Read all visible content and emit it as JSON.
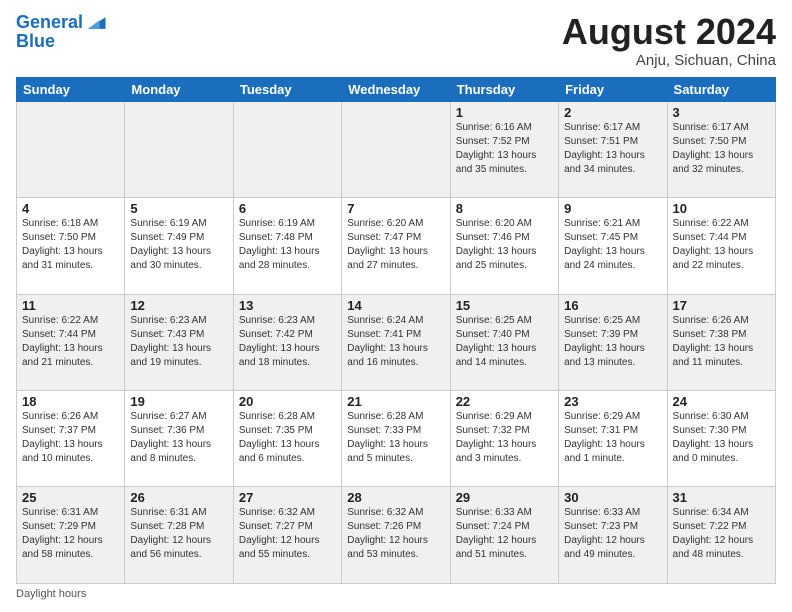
{
  "header": {
    "logo_line1": "General",
    "logo_line2": "Blue",
    "month_year": "August 2024",
    "location": "Anju, Sichuan, China"
  },
  "days_of_week": [
    "Sunday",
    "Monday",
    "Tuesday",
    "Wednesday",
    "Thursday",
    "Friday",
    "Saturday"
  ],
  "weeks": [
    [
      {
        "day": "",
        "info": ""
      },
      {
        "day": "",
        "info": ""
      },
      {
        "day": "",
        "info": ""
      },
      {
        "day": "",
        "info": ""
      },
      {
        "day": "1",
        "info": "Sunrise: 6:16 AM\nSunset: 7:52 PM\nDaylight: 13 hours and 35 minutes."
      },
      {
        "day": "2",
        "info": "Sunrise: 6:17 AM\nSunset: 7:51 PM\nDaylight: 13 hours and 34 minutes."
      },
      {
        "day": "3",
        "info": "Sunrise: 6:17 AM\nSunset: 7:50 PM\nDaylight: 13 hours and 32 minutes."
      }
    ],
    [
      {
        "day": "4",
        "info": "Sunrise: 6:18 AM\nSunset: 7:50 PM\nDaylight: 13 hours and 31 minutes."
      },
      {
        "day": "5",
        "info": "Sunrise: 6:19 AM\nSunset: 7:49 PM\nDaylight: 13 hours and 30 minutes."
      },
      {
        "day": "6",
        "info": "Sunrise: 6:19 AM\nSunset: 7:48 PM\nDaylight: 13 hours and 28 minutes."
      },
      {
        "day": "7",
        "info": "Sunrise: 6:20 AM\nSunset: 7:47 PM\nDaylight: 13 hours and 27 minutes."
      },
      {
        "day": "8",
        "info": "Sunrise: 6:20 AM\nSunset: 7:46 PM\nDaylight: 13 hours and 25 minutes."
      },
      {
        "day": "9",
        "info": "Sunrise: 6:21 AM\nSunset: 7:45 PM\nDaylight: 13 hours and 24 minutes."
      },
      {
        "day": "10",
        "info": "Sunrise: 6:22 AM\nSunset: 7:44 PM\nDaylight: 13 hours and 22 minutes."
      }
    ],
    [
      {
        "day": "11",
        "info": "Sunrise: 6:22 AM\nSunset: 7:44 PM\nDaylight: 13 hours and 21 minutes."
      },
      {
        "day": "12",
        "info": "Sunrise: 6:23 AM\nSunset: 7:43 PM\nDaylight: 13 hours and 19 minutes."
      },
      {
        "day": "13",
        "info": "Sunrise: 6:23 AM\nSunset: 7:42 PM\nDaylight: 13 hours and 18 minutes."
      },
      {
        "day": "14",
        "info": "Sunrise: 6:24 AM\nSunset: 7:41 PM\nDaylight: 13 hours and 16 minutes."
      },
      {
        "day": "15",
        "info": "Sunrise: 6:25 AM\nSunset: 7:40 PM\nDaylight: 13 hours and 14 minutes."
      },
      {
        "day": "16",
        "info": "Sunrise: 6:25 AM\nSunset: 7:39 PM\nDaylight: 13 hours and 13 minutes."
      },
      {
        "day": "17",
        "info": "Sunrise: 6:26 AM\nSunset: 7:38 PM\nDaylight: 13 hours and 11 minutes."
      }
    ],
    [
      {
        "day": "18",
        "info": "Sunrise: 6:26 AM\nSunset: 7:37 PM\nDaylight: 13 hours and 10 minutes."
      },
      {
        "day": "19",
        "info": "Sunrise: 6:27 AM\nSunset: 7:36 PM\nDaylight: 13 hours and 8 minutes."
      },
      {
        "day": "20",
        "info": "Sunrise: 6:28 AM\nSunset: 7:35 PM\nDaylight: 13 hours and 6 minutes."
      },
      {
        "day": "21",
        "info": "Sunrise: 6:28 AM\nSunset: 7:33 PM\nDaylight: 13 hours and 5 minutes."
      },
      {
        "day": "22",
        "info": "Sunrise: 6:29 AM\nSunset: 7:32 PM\nDaylight: 13 hours and 3 minutes."
      },
      {
        "day": "23",
        "info": "Sunrise: 6:29 AM\nSunset: 7:31 PM\nDaylight: 13 hours and 1 minute."
      },
      {
        "day": "24",
        "info": "Sunrise: 6:30 AM\nSunset: 7:30 PM\nDaylight: 13 hours and 0 minutes."
      }
    ],
    [
      {
        "day": "25",
        "info": "Sunrise: 6:31 AM\nSunset: 7:29 PM\nDaylight: 12 hours and 58 minutes."
      },
      {
        "day": "26",
        "info": "Sunrise: 6:31 AM\nSunset: 7:28 PM\nDaylight: 12 hours and 56 minutes."
      },
      {
        "day": "27",
        "info": "Sunrise: 6:32 AM\nSunset: 7:27 PM\nDaylight: 12 hours and 55 minutes."
      },
      {
        "day": "28",
        "info": "Sunrise: 6:32 AM\nSunset: 7:26 PM\nDaylight: 12 hours and 53 minutes."
      },
      {
        "day": "29",
        "info": "Sunrise: 6:33 AM\nSunset: 7:24 PM\nDaylight: 12 hours and 51 minutes."
      },
      {
        "day": "30",
        "info": "Sunrise: 6:33 AM\nSunset: 7:23 PM\nDaylight: 12 hours and 49 minutes."
      },
      {
        "day": "31",
        "info": "Sunrise: 6:34 AM\nSunset: 7:22 PM\nDaylight: 12 hours and 48 minutes."
      }
    ]
  ],
  "footer": {
    "label": "Daylight hours"
  }
}
